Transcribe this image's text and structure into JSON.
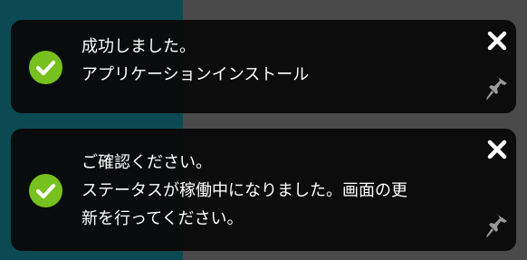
{
  "colors": {
    "success": "#76c11d",
    "toast_bg": "#080808",
    "text": "#ffffff",
    "pin": "#9a9a9a"
  },
  "notifications": [
    {
      "icon": "check-circle-icon",
      "lines": [
        "成功しました。",
        "アプリケーションインストール"
      ],
      "close_icon": "close-icon",
      "pin_icon": "pin-icon"
    },
    {
      "icon": "check-circle-icon",
      "lines": [
        "ご確認ください。",
        "ステータスが稼働中になりました。画面の更",
        "新を行ってください。"
      ],
      "close_icon": "close-icon",
      "pin_icon": "pin-icon"
    }
  ]
}
